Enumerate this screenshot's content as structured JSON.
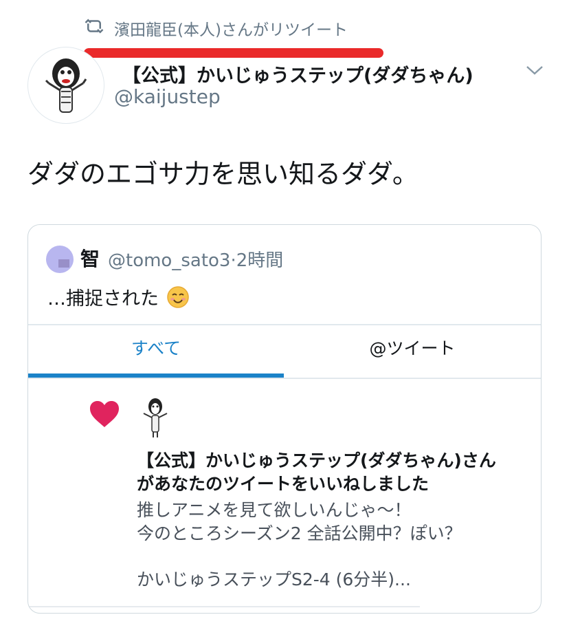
{
  "retweet": {
    "icon": "retweet-icon",
    "text": "濱田龍臣(本人)さんがリツイート"
  },
  "author": {
    "name": "【公式】かいじゅうステップ(ダダちゃん)",
    "handle": "@kaijustep",
    "avatar_icon": "dada-character-avatar"
  },
  "tweet": {
    "text": "ダダのエゴサ力を思い知るダダ。"
  },
  "quote": {
    "name": "智",
    "handle": "@tomo_sato3",
    "time": "·2時間",
    "text": "…捕捉された",
    "emoji": "smiling-face-emoji",
    "embedded": {
      "tabs": [
        "すべて",
        "@ツイート"
      ],
      "active_tab": "すべて",
      "notification": {
        "line1": "【公式】かいじゅうステップ(ダダちゃん)さん",
        "line2": "があなたのツイートをいいねしました",
        "body": "推しアニメを見て欲しいんじゃ～！\n今のところシーズン2 全話公開中？ぽい？",
        "title": "かいじゅうステップS2-4 (6分半)..."
      }
    }
  },
  "colors": {
    "accent": "#1b82c8",
    "annotation_red": "#ea2a2a",
    "heart": "#e0245e"
  }
}
